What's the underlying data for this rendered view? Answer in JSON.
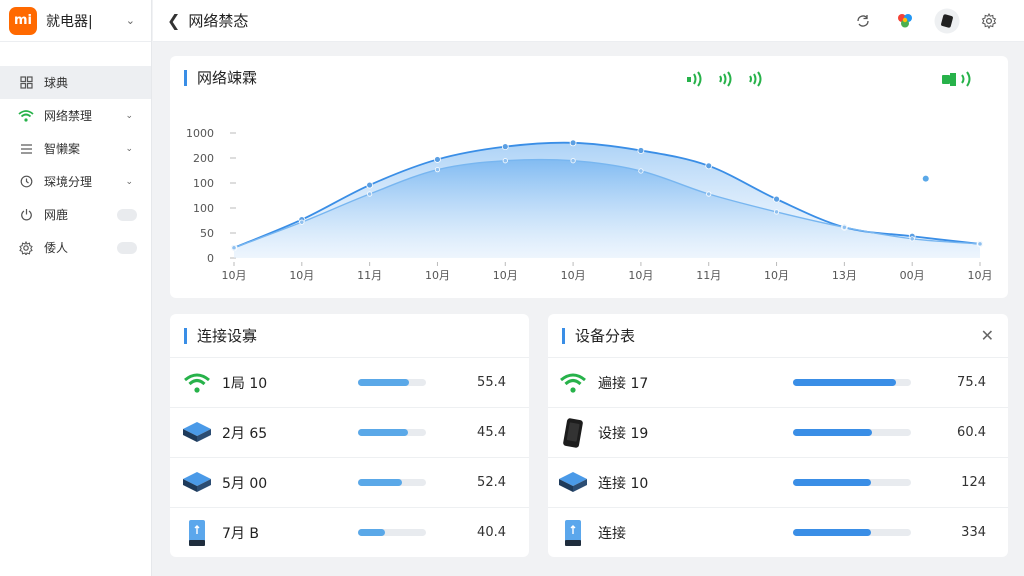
{
  "app": {
    "logo_text": "mi",
    "name": "就电器|"
  },
  "topbar": {
    "title": "网络禁态"
  },
  "sidebar": {
    "items": [
      {
        "label": "球典",
        "icon": "grid-icon",
        "active": true
      },
      {
        "label": "网络禁理",
        "icon": "wifi-icon",
        "chevron": true
      },
      {
        "label": "智懒案",
        "icon": "list-icon",
        "chevron": true
      },
      {
        "label": "琛境分理",
        "icon": "clock-icon",
        "chevron": true
      },
      {
        "label": "网鹿",
        "icon": "power-icon",
        "toggle": true
      },
      {
        "label": "倭人",
        "icon": "gear-icon",
        "toggle": true
      }
    ]
  },
  "chart_card": {
    "title": "网络竦霖",
    "chart_data": {
      "type": "area",
      "y_tick_labels": [
        "1000",
        "200",
        "100",
        "100",
        "50",
        "0"
      ],
      "x": [
        "10月",
        "10月",
        "11月",
        "10月",
        "10月",
        "10月",
        "10月",
        "11月",
        "10月",
        "13月",
        "00月",
        "10月"
      ],
      "series": [
        {
          "values": [
            0.08,
            0.3,
            0.57,
            0.77,
            0.87,
            0.9,
            0.84,
            0.72,
            0.46,
            0.24,
            0.17,
            0.11
          ],
          "color": "#3a8ee6"
        },
        {
          "values": [
            0.08,
            0.28,
            0.5,
            0.69,
            0.76,
            0.76,
            0.68,
            0.5,
            0.36,
            0.24,
            0.15,
            0.11
          ],
          "color": "#78b6f0"
        }
      ],
      "outlier": {
        "x_index": 10.2,
        "value": 0.62
      },
      "grid": false
    },
    "colors": {
      "accent": "#3a8ee6",
      "signal_green": "#27b24a"
    }
  },
  "connected_devices": {
    "title": "连接设寡",
    "rows": [
      {
        "icon": "wifi-icon",
        "label": "1局 10",
        "value": "55.4",
        "fill": 0.75
      },
      {
        "icon": "router-icon",
        "label": "2月 65",
        "value": "45.4",
        "fill": 0.73
      },
      {
        "icon": "router-icon",
        "label": "5月 00",
        "value": "52.4",
        "fill": 0.65
      },
      {
        "icon": "phone-icon",
        "label": "7月 B",
        "value": "40.4",
        "fill": 0.4
      }
    ]
  },
  "device_list": {
    "title": "设备分表",
    "rows": [
      {
        "icon": "wifi-icon",
        "label": "遍接 17",
        "value": "75.4",
        "fill": 0.87
      },
      {
        "icon": "phone-dark-icon",
        "label": "设接 19",
        "value": "60.4",
        "fill": 0.67
      },
      {
        "icon": "router-icon",
        "label": "连接 10",
        "value": "124",
        "fill": 0.66
      },
      {
        "icon": "phone-icon",
        "label": "连接",
        "value": "334",
        "fill": 0.66
      }
    ]
  }
}
